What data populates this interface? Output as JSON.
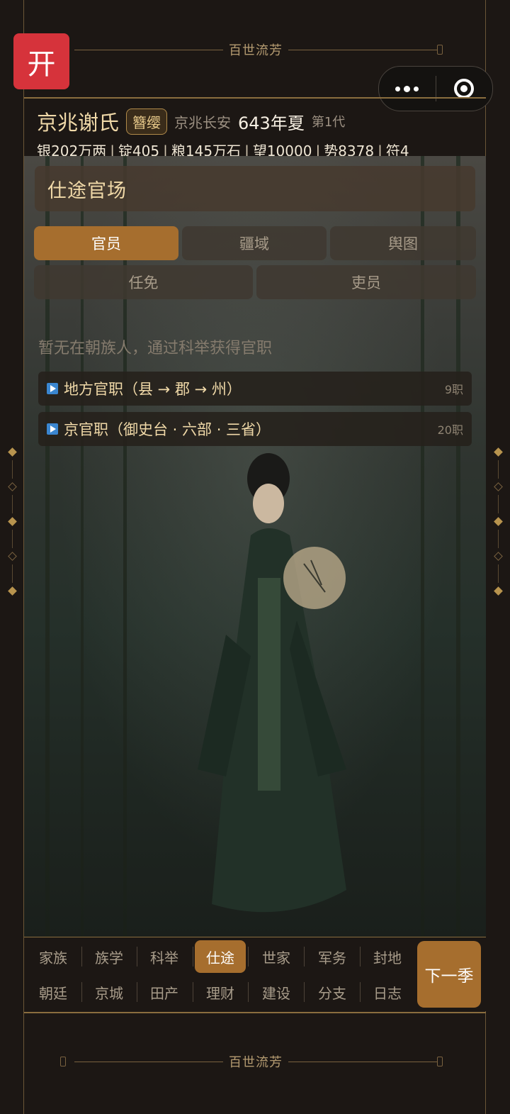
{
  "banner_top": "百世流芳",
  "banner_bottom": "百世流芳",
  "open_button": "开",
  "header": {
    "clan_name": "京兆谢氏",
    "rank_badge": "簪缨",
    "location": "京兆长安",
    "date": "643年夏",
    "generation": "第1代"
  },
  "stats": [
    "银202万两",
    "锭405",
    "粮145万石",
    "望10000",
    "势8378",
    "符4"
  ],
  "panel": {
    "title": "仕途官场",
    "tabs_row1": [
      "官员",
      "疆域",
      "舆图"
    ],
    "tabs_row2": [
      "任免",
      "吏员"
    ],
    "active_tab": "官员",
    "empty_message": "暂无在朝族人，通过科举获得官职",
    "categories": [
      {
        "label": "地方官职（县 → 郡 → 州）",
        "count": "9职"
      },
      {
        "label": "京官职（御史台 · 六部 · 三省）",
        "count": "20职"
      }
    ]
  },
  "nav": {
    "row1": [
      "家族",
      "族学",
      "科举",
      "仕途",
      "世家",
      "军务",
      "封地"
    ],
    "row2": [
      "朝廷",
      "京城",
      "田产",
      "理财",
      "建设",
      "分支",
      "日志"
    ],
    "active": "仕途",
    "next_button": "下一季"
  },
  "colors": {
    "accent": "#a66e2e",
    "gold_text": "#f0d9a8",
    "open_button": "#d6333b",
    "background": "#1c1714"
  }
}
